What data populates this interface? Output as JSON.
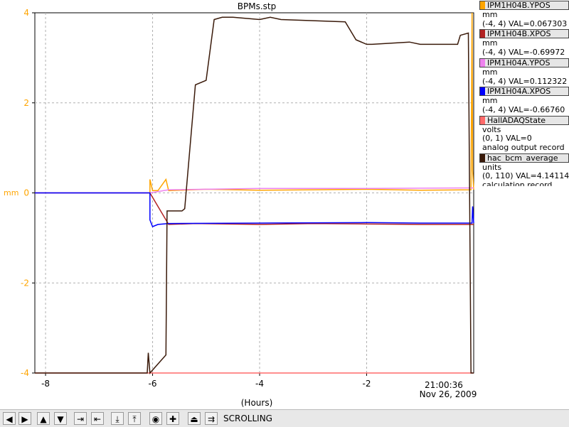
{
  "chart_data": {
    "type": "line",
    "title": "BPMs.stp",
    "xlabel": "(Hours)",
    "ylabel": "mm",
    "xlim": [
      -8.2,
      0
    ],
    "ylim": [
      -4,
      4
    ],
    "x_ticks": [
      -8,
      -6,
      -4,
      -2
    ],
    "x_tick_labels": [
      "-8",
      "-6",
      "-4",
      "-2"
    ],
    "y_ticks": [
      -4,
      -2,
      0,
      2,
      4
    ],
    "y_tick_labels": [
      "-4",
      "-2",
      "0",
      "2",
      "4"
    ],
    "end_time": "21:00:36",
    "end_date": "Nov 26, 2009",
    "grid": true,
    "series": [
      {
        "name": "IPM1H04B.YPOS",
        "color": "#ffa500",
        "x": [
          -8.2,
          -6.05,
          -6.05,
          -6.0,
          -5.9,
          -5.75,
          -5.7,
          -5.0,
          -4.0,
          -3.0,
          -2.0,
          -1.0,
          -0.05,
          -0.03,
          -0.02,
          0
        ],
        "y": [
          0.0,
          0.0,
          0.3,
          0.05,
          0.05,
          0.3,
          0.05,
          0.08,
          0.06,
          0.07,
          0.08,
          0.06,
          0.07,
          4.0,
          0.5,
          0.07
        ]
      },
      {
        "name": "IPM1H04B.XPOS",
        "color": "#b22222",
        "x": [
          -8.2,
          -6.05,
          -5.7,
          -5.2,
          -4.0,
          -3.0,
          -2.0,
          -1.0,
          0
        ],
        "y": [
          0.0,
          0.0,
          -0.7,
          -0.68,
          -0.7,
          -0.68,
          -0.69,
          -0.7,
          -0.7
        ]
      },
      {
        "name": "IPM1H04A.YPOS",
        "color": "#ee82ee",
        "x": [
          -8.2,
          -6.05,
          -5.7,
          -4.0,
          -2.0,
          0
        ],
        "y": [
          0.0,
          0.0,
          0.07,
          0.1,
          0.1,
          0.11
        ]
      },
      {
        "name": "IPM1H04A.XPOS",
        "color": "#0000ff",
        "x": [
          -8.2,
          -6.05,
          -6.05,
          -6.0,
          -5.9,
          -5.7,
          -4.0,
          -2.0,
          -1.0,
          -0.03,
          -0.02,
          0
        ],
        "y": [
          0.0,
          0.0,
          -0.6,
          -0.75,
          -0.7,
          -0.68,
          -0.67,
          -0.66,
          -0.67,
          -0.67,
          -0.3,
          -0.67
        ]
      },
      {
        "name": "HallADAQState",
        "color": "#ff6a6a",
        "x": [
          -8.2,
          0
        ],
        "y": [
          -4.0,
          -4.0
        ]
      },
      {
        "name": "hac_bcm_average",
        "color": "#3a1a0a",
        "x": [
          -8.2,
          -6.1,
          -6.08,
          -6.05,
          -5.75,
          -5.73,
          -5.45,
          -5.4,
          -5.2,
          -5.0,
          -4.85,
          -4.7,
          -4.5,
          -4.0,
          -3.8,
          -3.6,
          -2.4,
          -2.2,
          -2.0,
          -1.9,
          -1.2,
          -1.0,
          -0.8,
          -0.65,
          -0.3,
          -0.25,
          -0.1,
          -0.05,
          0
        ],
        "y": [
          -4.0,
          -4.0,
          -3.55,
          -4.0,
          -3.6,
          -0.4,
          -0.4,
          -0.35,
          2.4,
          2.5,
          3.85,
          3.9,
          3.9,
          3.85,
          3.9,
          3.85,
          3.8,
          3.4,
          3.3,
          3.3,
          3.35,
          3.3,
          3.3,
          3.3,
          3.3,
          3.5,
          3.55,
          -4.0,
          -4.0
        ]
      }
    ]
  },
  "legend": [
    {
      "name": "IPM1H04B.YPOS",
      "color": "#ffa500",
      "unit": "mm",
      "range": "(-4, 4) VAL=0.067303",
      "desc": ""
    },
    {
      "name": "IPM1H04B.XPOS",
      "color": "#b22222",
      "unit": "mm",
      "range": "(-4, 4) VAL=-0.69972",
      "desc": ""
    },
    {
      "name": "IPM1H04A.YPOS",
      "color": "#ee82ee",
      "unit": "mm",
      "range": "(-4, 4) VAL=0.112322",
      "desc": ""
    },
    {
      "name": "IPM1H04A.XPOS",
      "color": "#0000ff",
      "unit": "mm",
      "range": "(-4, 4) VAL=-0.66760",
      "desc": ""
    },
    {
      "name": "HallADAQState",
      "color": "#ff6a6a",
      "unit": "volts",
      "range": "(0, 1) VAL=0",
      "desc": "analog output record"
    },
    {
      "name": "hac_bcm_average",
      "color": "#3a1a0a",
      "unit": "units",
      "range": "(0, 110) VAL=4.14114",
      "desc": "calculation record"
    }
  ],
  "toolbar": {
    "status": "SCROLLING",
    "buttons": [
      {
        "icon": "pan-left-icon",
        "glyph": "◀"
      },
      {
        "icon": "pan-right-icon",
        "glyph": "▶"
      },
      {
        "icon": "pan-up-icon",
        "glyph": "▲"
      },
      {
        "icon": "pan-down-icon",
        "glyph": "▼"
      },
      {
        "icon": "zoom-in-x-icon",
        "glyph": "⇥"
      },
      {
        "icon": "zoom-out-x-icon",
        "glyph": "⇤"
      },
      {
        "icon": "zoom-in-y-icon",
        "glyph": "⤓"
      },
      {
        "icon": "zoom-out-y-icon",
        "glyph": "⤒"
      },
      {
        "icon": "autoscale-icon",
        "glyph": "◉"
      },
      {
        "icon": "add-icon",
        "glyph": "✚"
      },
      {
        "icon": "toggle-scroll-icon",
        "glyph": "⏏"
      },
      {
        "icon": "scroll-icon",
        "glyph": "⇉"
      }
    ]
  }
}
